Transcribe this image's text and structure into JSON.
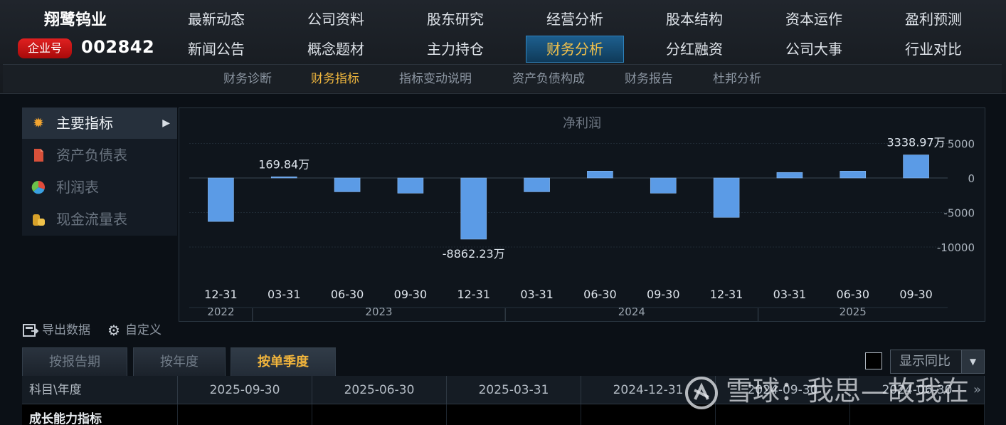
{
  "brand": {
    "name": "翔鹭钨业",
    "badge": "企业号",
    "code": "002842"
  },
  "nav": {
    "row1": [
      "最新动态",
      "公司资料",
      "股东研究",
      "经营分析",
      "股本结构",
      "资本运作",
      "盈利预测"
    ],
    "row2": [
      "新闻公告",
      "概念题材",
      "主力持仓",
      "财务分析",
      "分红融资",
      "公司大事",
      "行业对比"
    ],
    "active": "财务分析"
  },
  "subnav": {
    "items": [
      "财务诊断",
      "财务指标",
      "指标变动说明",
      "资产负债构成",
      "财务报告",
      "杜邦分析"
    ],
    "active": "财务指标"
  },
  "menu": {
    "items": [
      {
        "label": "主要指标",
        "icon": "sun-icon"
      },
      {
        "label": "资产负债表",
        "icon": "document-icon"
      },
      {
        "label": "利润表",
        "icon": "pie-icon"
      },
      {
        "label": "现金流量表",
        "icon": "coins-icon"
      }
    ],
    "active": "主要指标"
  },
  "chart_data": {
    "type": "bar",
    "title": "净利润",
    "unit": "万",
    "categories": [
      "12-31",
      "03-31",
      "06-30",
      "09-30",
      "12-31",
      "03-31",
      "06-30",
      "09-30",
      "12-31",
      "03-31",
      "06-30",
      "09-30"
    ],
    "years": [
      {
        "label": "2022",
        "start": 0,
        "end": 0
      },
      {
        "label": "2023",
        "start": 1,
        "end": 4
      },
      {
        "label": "2024",
        "start": 5,
        "end": 8
      },
      {
        "label": "2025",
        "start": 9,
        "end": 11
      }
    ],
    "series": [
      {
        "values": [
          -6300,
          169.84,
          -2000,
          -2200,
          -8862.23,
          -2000,
          1000,
          -2200,
          -5700,
          800,
          1000,
          3338.97
        ]
      }
    ],
    "annotations": [
      {
        "index": 1,
        "text": "169.84万"
      },
      {
        "index": 4,
        "text": "-8862.23万"
      },
      {
        "index": 11,
        "text": "3338.97万"
      }
    ],
    "yticks": [
      5000,
      0,
      -5000,
      -10000
    ],
    "ytick_labels": [
      "5000",
      "0",
      "-5000",
      "-10000"
    ],
    "ylim": [
      -13000,
      8000
    ],
    "bar_color": "#5b9be6",
    "grid": true
  },
  "tools": {
    "export": "导出数据",
    "custom": "自定义"
  },
  "tabs": {
    "items": [
      "按报告期",
      "按年度",
      "按单季度"
    ],
    "active": "按单季度"
  },
  "yoy": {
    "label": "显示同比",
    "checked": false
  },
  "table": {
    "headers": [
      "科目\\年度",
      "2025-09-30",
      "2025-06-30",
      "2025-03-31",
      "2024-12-31",
      "2024-09-30",
      "2024-06-30"
    ],
    "row_title": "成长能力指标"
  },
  "watermark": {
    "text": "雪球：我思—故我在"
  },
  "colors": {
    "accent": "#f2b53c",
    "active_nav_bg": "#1d5f8e",
    "badge": "#d21616"
  }
}
